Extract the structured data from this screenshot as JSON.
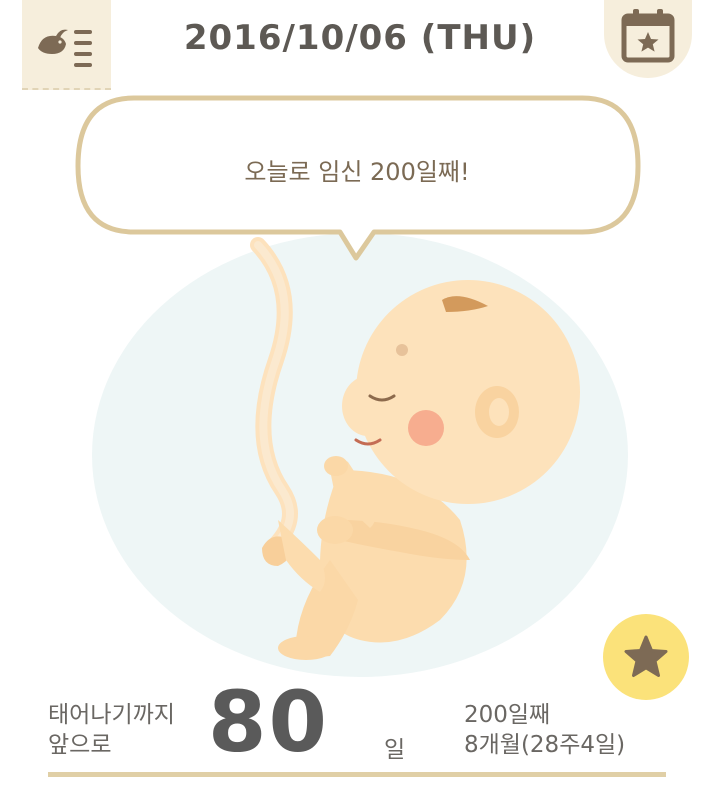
{
  "header": {
    "date": "2016/10/06 (THU)",
    "menu_icon": "bird-list-icon",
    "calendar_icon": "calendar-star-icon"
  },
  "bubble": {
    "message": "오늘로 임신 200일째!"
  },
  "illustration": {
    "description_icon": "fetus-illustration"
  },
  "favorite": {
    "icon": "star-icon"
  },
  "countdown": {
    "label_line1": "태어나기까지",
    "label_line2": "앞으로",
    "days_remaining": "80",
    "unit": "일",
    "day_count": "200일째",
    "month_week": "8개월(28주4일)"
  },
  "colors": {
    "accent_beige": "#f6eedc",
    "bubble_border": "#dcc89c",
    "favorite_yellow": "#fbe27a",
    "icon_brown": "#7d6a55"
  }
}
